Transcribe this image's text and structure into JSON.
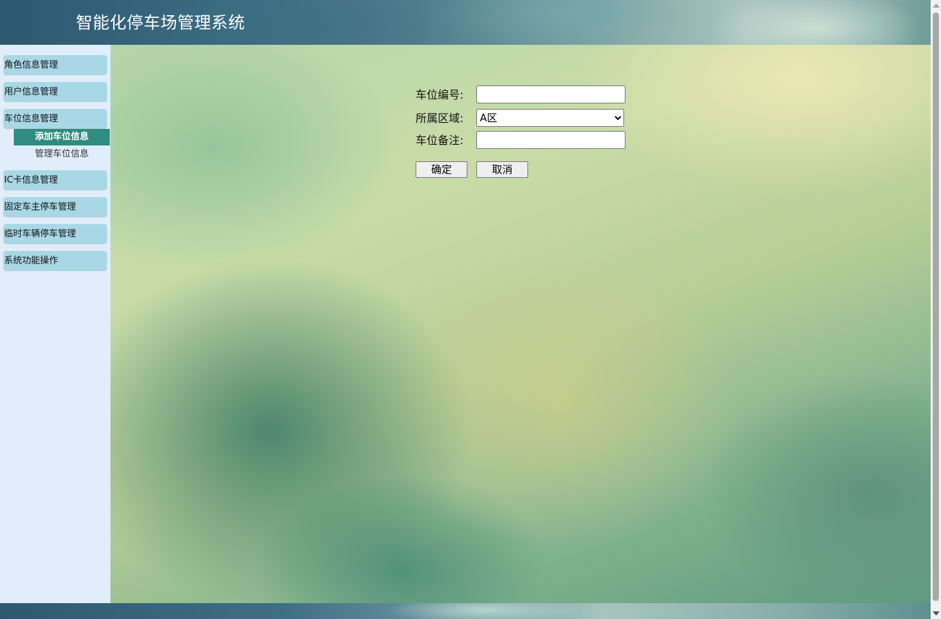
{
  "header": {
    "title": "智能化停车场管理系统"
  },
  "sidebar": {
    "groups": [
      {
        "label": "角色信息管理"
      },
      {
        "label": "用户信息管理"
      },
      {
        "label": "车位信息管理"
      },
      {
        "label": "IC卡信息管理"
      },
      {
        "label": "固定车主停车管理"
      },
      {
        "label": "临时车辆停车管理"
      },
      {
        "label": "系统功能操作"
      }
    ],
    "sub_items": [
      {
        "label": "添加车位信息",
        "active": true
      },
      {
        "label": "管理车位信息",
        "active": false
      }
    ]
  },
  "form": {
    "space_number": {
      "label": "车位编号:",
      "value": ""
    },
    "area": {
      "label": "所属区域:",
      "selected": "A区"
    },
    "remark": {
      "label": "车位备注:",
      "value": ""
    },
    "confirm_label": "确定",
    "cancel_label": "取消"
  },
  "colors": {
    "header_bg": "#3a6b82",
    "sidebar_bg": "#e1eefa",
    "menu_group_bg": "#a8d8e6",
    "active_sub_bg": "#2e8c80"
  }
}
